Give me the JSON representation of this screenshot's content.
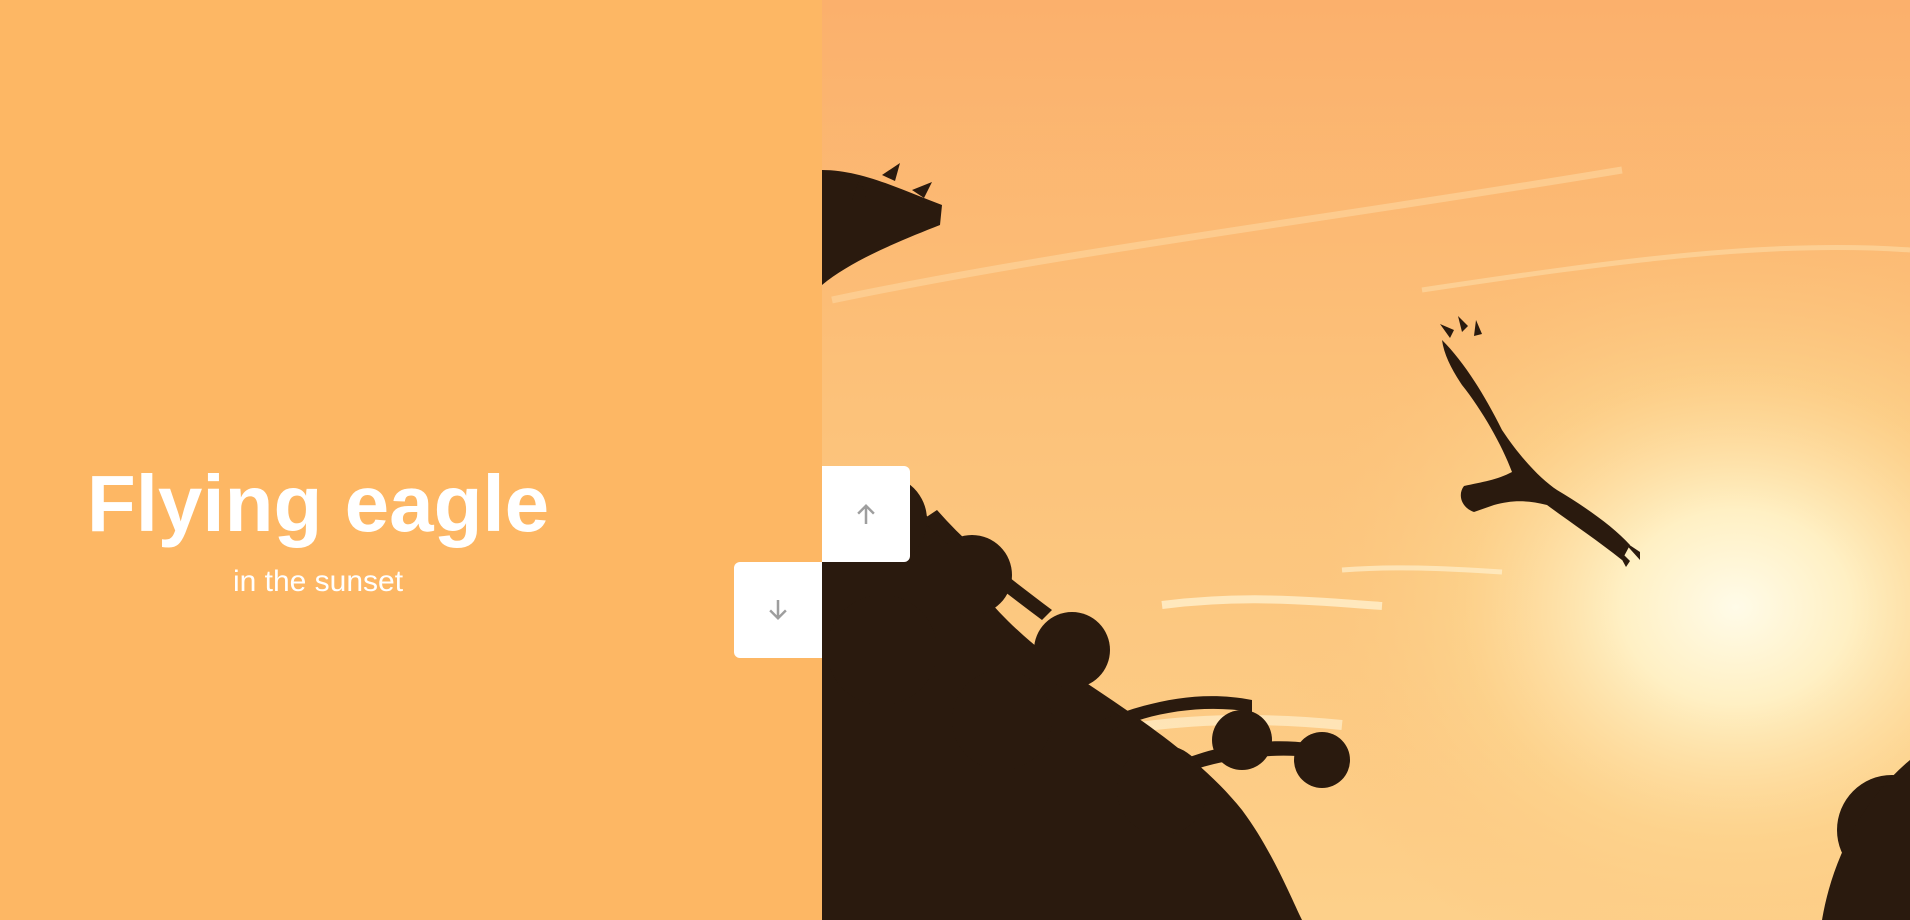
{
  "slide": {
    "title": "Flying eagle",
    "subtitle": "in the sunset",
    "left_panel_color": "#fdb764",
    "image_subject": "eagle silhouette flying over pine branches against a sunset sky"
  },
  "controls": {
    "up_icon": "arrow-up-icon",
    "down_icon": "arrow-down-icon",
    "icon_color": "#9e9e9e",
    "button_color": "#ffffff"
  }
}
